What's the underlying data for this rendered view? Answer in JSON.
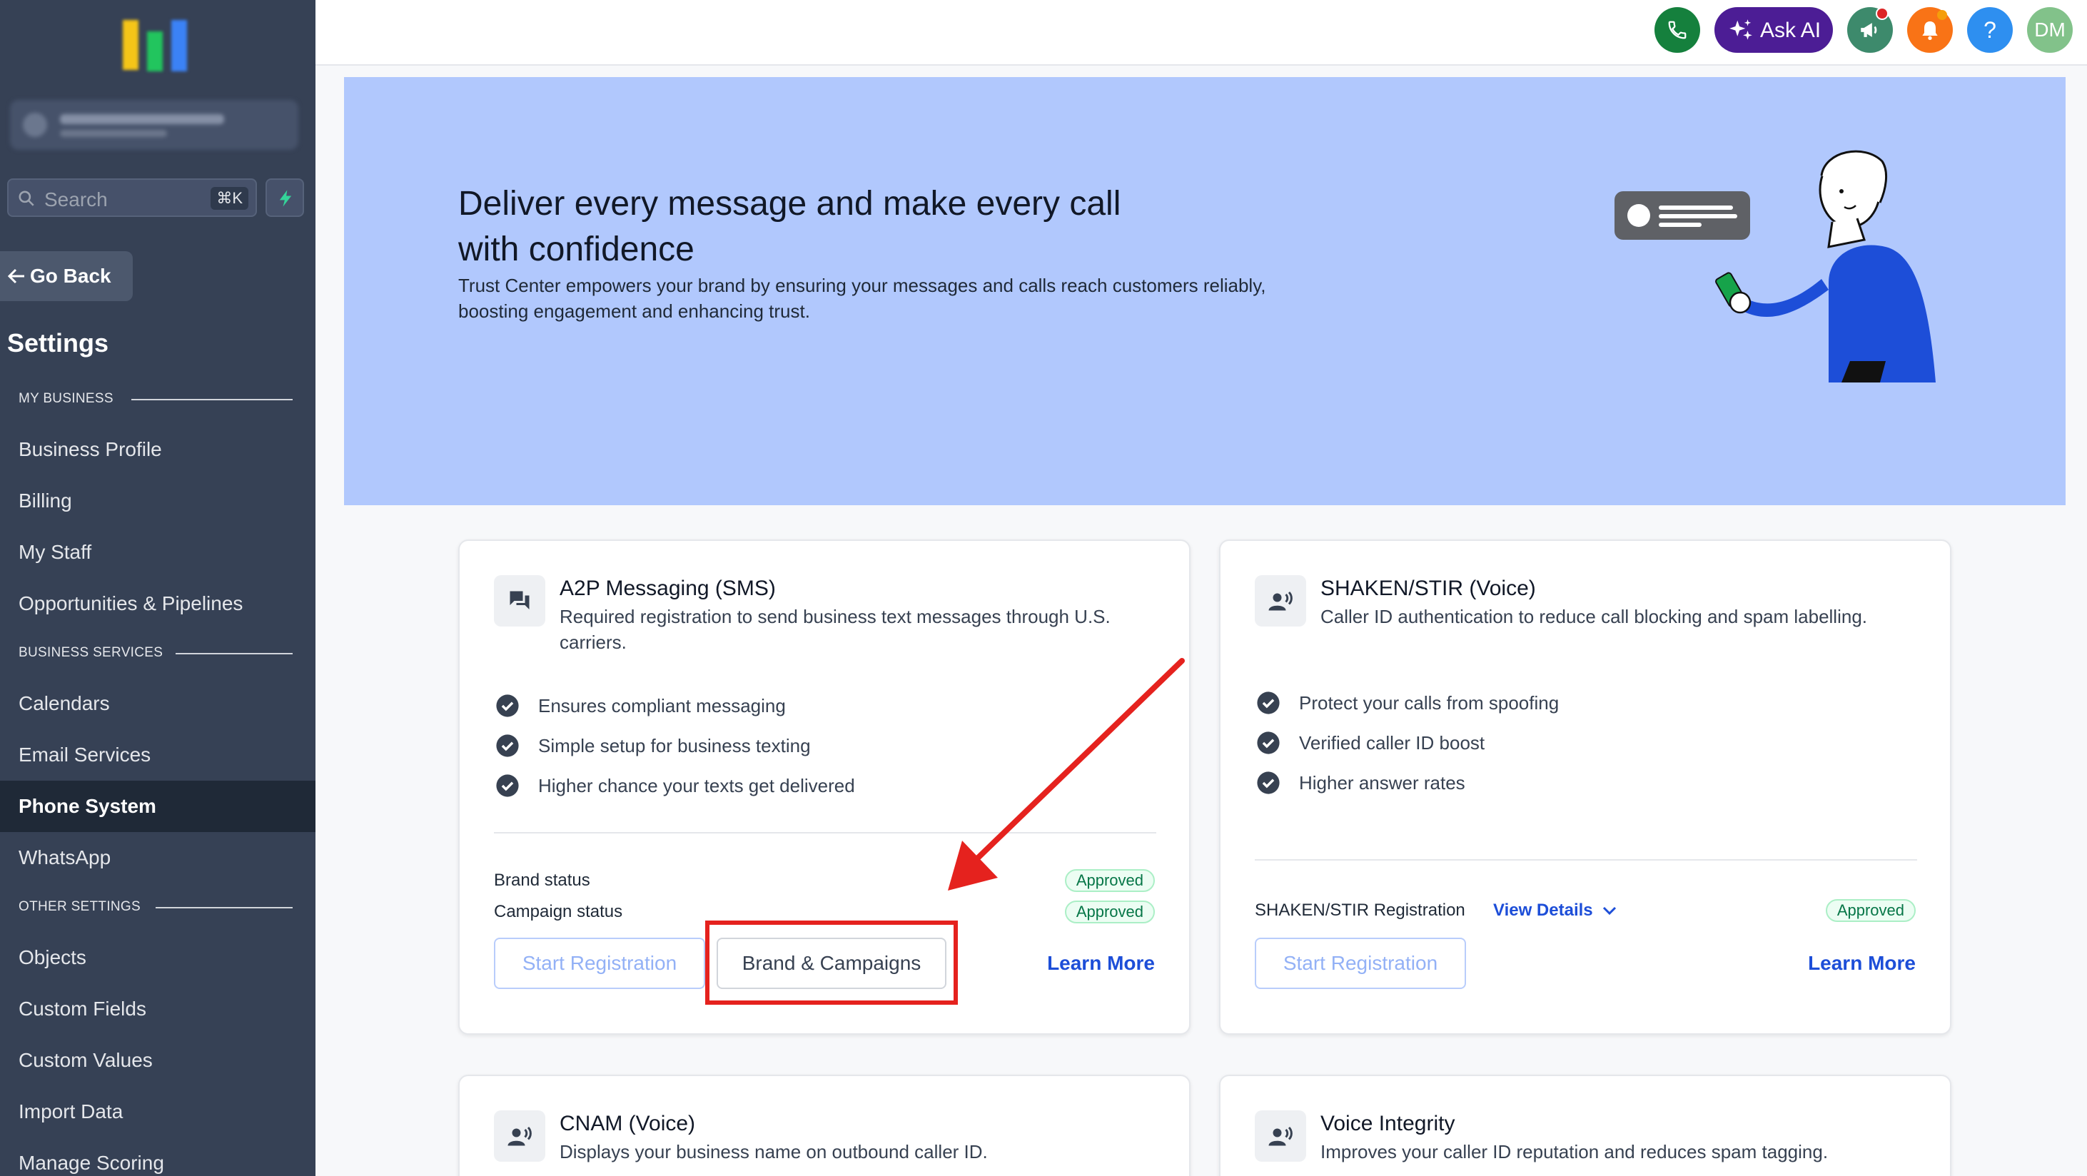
{
  "sidebar": {
    "search_label": "Search",
    "search_shortcut": "⌘K",
    "go_back": "Go Back",
    "settings_title": "Settings",
    "sections": {
      "my_business": "MY BUSINESS",
      "business_services": "BUSINESS SERVICES",
      "other_settings": "OTHER SETTINGS"
    },
    "items": [
      "Business Profile",
      "Billing",
      "My Staff",
      "Opportunities & Pipelines",
      "Calendars",
      "Email Services",
      "Phone System",
      "WhatsApp",
      "Objects",
      "Custom Fields",
      "Custom Values",
      "Import Data",
      "Manage Scoring"
    ],
    "active_item": "Phone System"
  },
  "header": {
    "ask_ai": "Ask AI",
    "avatar_initials": "DM",
    "help": "?"
  },
  "banner": {
    "title": "Deliver every message and make every call with confidence",
    "subtitle": "Trust Center empowers your brand by ensuring your messages and calls reach customers reliably, boosting engagement and enhancing trust."
  },
  "cards": {
    "a2p": {
      "title": "A2P Messaging (SMS)",
      "description": "Required registration to send business text messages through U.S. carriers.",
      "features": [
        "Ensures compliant messaging",
        "Simple setup for business texting",
        "Higher chance your texts get delivered"
      ],
      "brand_status_label": "Brand status",
      "brand_status": "Approved",
      "campaign_status_label": "Campaign status",
      "campaign_status": "Approved",
      "start_registration": "Start Registration",
      "brand_campaigns": "Brand & Campaigns",
      "learn_more": "Learn More"
    },
    "shaken": {
      "title": "SHAKEN/STIR (Voice)",
      "description": "Caller ID authentication to reduce call blocking and spam labelling.",
      "features": [
        "Protect your calls from spoofing",
        "Verified caller ID boost",
        "Higher answer rates"
      ],
      "registration_label": "SHAKEN/STIR Registration",
      "view_details": "View Details",
      "status": "Approved",
      "start_registration": "Start Registration",
      "learn_more": "Learn More"
    },
    "cnam": {
      "title": "CNAM (Voice)",
      "description": "Displays your business name on outbound caller ID."
    },
    "voice_integrity": {
      "title": "Voice Integrity",
      "description": "Improves your caller ID reputation and reduces spam tagging."
    }
  },
  "colors": {
    "sidebar_bg": "#364155",
    "banner_bg": "#b1c8fd",
    "accent_link": "#1d4ed8",
    "highlight_red": "#e5221e"
  }
}
